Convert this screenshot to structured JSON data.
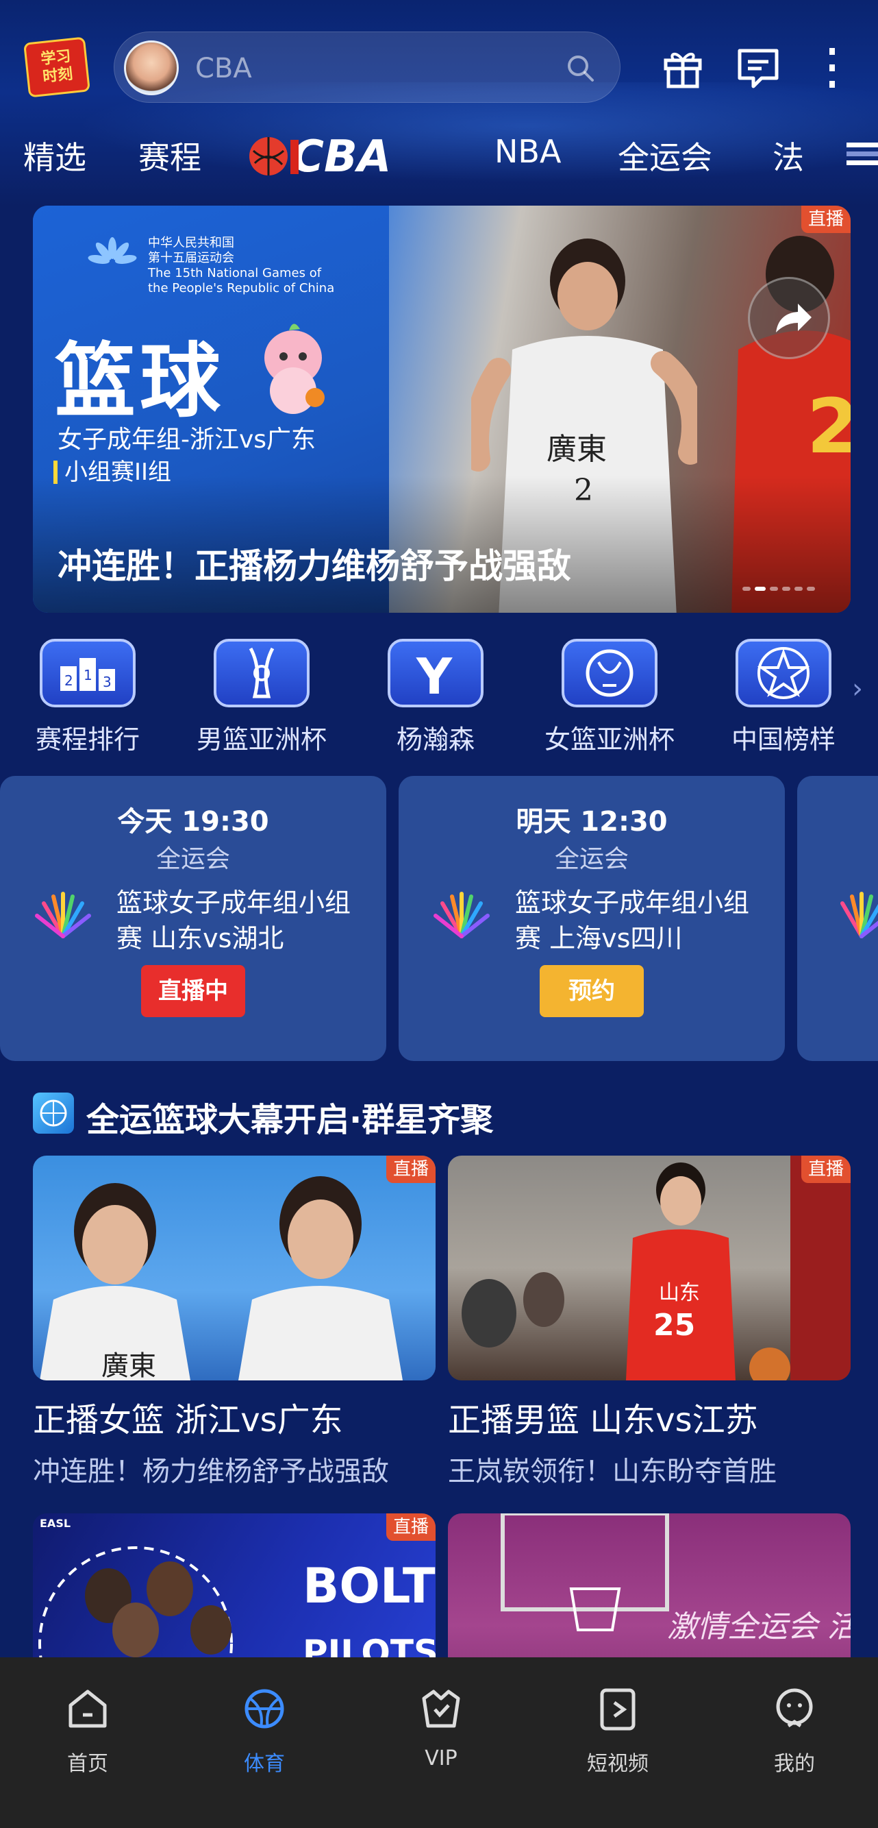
{
  "header": {
    "logo_text_line1": "学习",
    "logo_text_line2": "时刻",
    "search_placeholder": "CBA",
    "icons": [
      "gift-icon",
      "message-icon",
      "more-vertical-icon"
    ]
  },
  "tabs": [
    {
      "label": "精选"
    },
    {
      "label": "赛程"
    },
    {
      "label": "CBA",
      "type": "logo"
    },
    {
      "label": "NBA"
    },
    {
      "label": "全运会"
    },
    {
      "label": "法"
    }
  ],
  "banner": {
    "badge": "直播",
    "games_logo_text": "中华人民共和国\n第十五届运动会\nThe 15th National Games of\nthe People's Republic of China",
    "big_text": "篮球",
    "sub1": "女子成年组-浙江vs广东",
    "sub2": "小组赛II组",
    "title": "冲连胜！正播杨力维杨舒予战强敌",
    "jersey_text": "廣東",
    "jersey_number": "2",
    "page_count": 6,
    "active_page": 2
  },
  "quick_links": [
    {
      "label": "赛程排行",
      "icon": "ranking-icon"
    },
    {
      "label": "男篮亚洲杯",
      "icon": "asia-cup-men-icon"
    },
    {
      "label": "杨瀚森",
      "icon": "yang-hansen-icon"
    },
    {
      "label": "女篮亚洲杯",
      "icon": "asia-cup-women-icon"
    },
    {
      "label": "中国榜样",
      "icon": "china-star-icon"
    }
  ],
  "matches": [
    {
      "time": "今天 19:30",
      "competition": "全运会",
      "title_line1": "篮球女子成年组小组",
      "title_line2": "赛 山东vs湖北",
      "button": "直播中",
      "button_type": "live"
    },
    {
      "time": "明天 12:30",
      "competition": "全运会",
      "title_line1": "篮球女子成年组小组",
      "title_line2": "赛 上海vs四川",
      "button": "预约",
      "button_type": "reserve"
    }
  ],
  "section": {
    "title": "全运篮球大幕开启·群星齐聚"
  },
  "videos": [
    {
      "badge": "直播",
      "title": "正播女篮 浙江vs广东",
      "subtitle": "冲连胜！杨力维杨舒予战强敌",
      "jersey": "廣東"
    },
    {
      "badge": "直播",
      "title": "正播男篮 山东vs江苏",
      "subtitle": "王岚嵚领衔！山东盼夺首胜",
      "jersey": "山东",
      "number": "25"
    },
    {
      "badge": "直播",
      "title": "",
      "subtitle": "",
      "poster_text1": "BOLTS",
      "poster_text2": "PILOTS",
      "poster_tag": "EASL"
    },
    {
      "badge": "",
      "title": "",
      "subtitle": "",
      "poster_text1": "激情全运会 活"
    }
  ],
  "bottom_nav": [
    {
      "label": "首页",
      "icon": "home-icon",
      "active": false
    },
    {
      "label": "体育",
      "icon": "basketball-icon",
      "active": true
    },
    {
      "label": "VIP",
      "icon": "vip-icon",
      "active": false
    },
    {
      "label": "短视频",
      "icon": "short-video-icon",
      "active": false
    },
    {
      "label": "我的",
      "icon": "profile-icon",
      "active": false
    }
  ],
  "colors": {
    "background": "#0b1f63",
    "card": "#2a4c97",
    "live": "#e82e2c",
    "reserve": "#f4b430",
    "badge": "#e2502f",
    "nav_active": "#3c8cff",
    "nav_bg": "#232323"
  }
}
